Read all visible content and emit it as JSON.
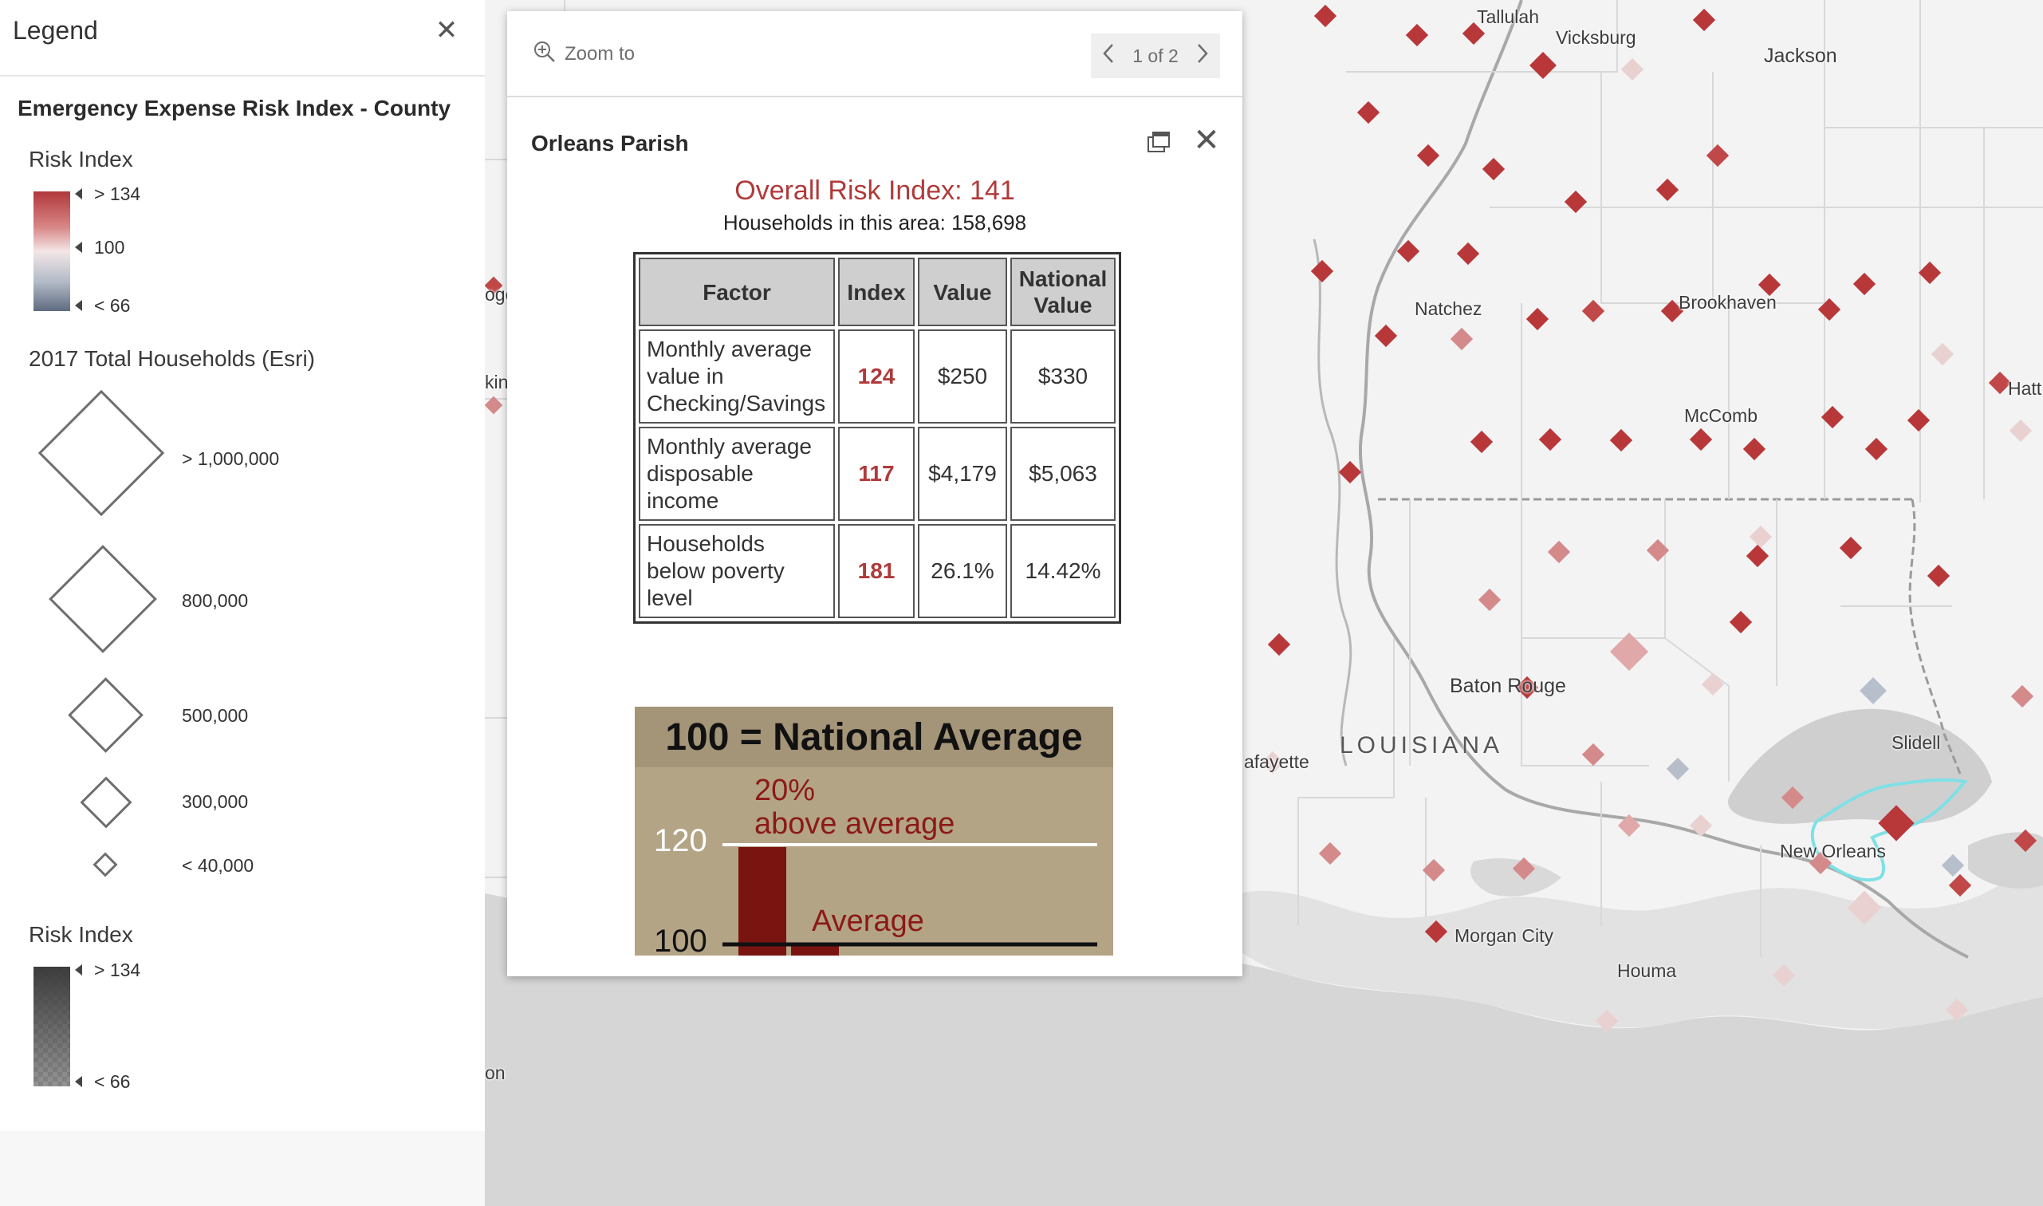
{
  "legend": {
    "title": "Legend",
    "close_icon": "close-icon",
    "layer_title": "Emergency Expense Risk Index - County",
    "risk_index_title": "Risk Index",
    "risk_ramp_labels": [
      "> 134",
      "100",
      "< 66"
    ],
    "risk_ramp_colors": [
      "#b0383a",
      "#f1dede",
      "#5e6b80"
    ],
    "households_title": "2017 Total Households (Esri)",
    "size_labels": [
      "> 1,000,000",
      "800,000",
      "500,000",
      "300,000",
      "< 40,000"
    ],
    "risk_index_title_2": "Risk Index",
    "risk_ramp2_labels": [
      "> 134",
      "< 66"
    ]
  },
  "popup": {
    "zoom_label": "Zoom to",
    "pager_text": "1 of 2",
    "feature_title": "Orleans Parish",
    "headline": "Overall Risk Index: 141",
    "households_text": "Households in this area: 158,698",
    "table": {
      "headers": [
        "Factor",
        "Index",
        "Value",
        "National Value"
      ],
      "rows": [
        {
          "factor": "Monthly average value in Checking/Savings",
          "index": "124",
          "value": "$250",
          "national": "$330"
        },
        {
          "factor": "Monthly average disposable income",
          "index": "117",
          "value": "$4,179",
          "national": "$5,063"
        },
        {
          "factor": "Households below poverty level",
          "index": "181",
          "value": "26.1%",
          "national": "14.42%"
        }
      ]
    },
    "infographic": {
      "title": "100 = National Average",
      "label_120": "120",
      "label_100": "100",
      "above_text_1": "20%",
      "above_text_2": "above average",
      "average_text": "Average"
    }
  },
  "map": {
    "state_label": "LOUISIANA",
    "cities": [
      "Tallulah",
      "Vicksburg",
      "Jackson",
      "Natchez",
      "Brookhaven",
      "McComb",
      "Baton Rouge",
      "Slidell",
      "New Orleans",
      "Morgan City",
      "Houma",
      "afayette",
      "Hatt",
      "ogo",
      "kin",
      "on"
    ]
  }
}
